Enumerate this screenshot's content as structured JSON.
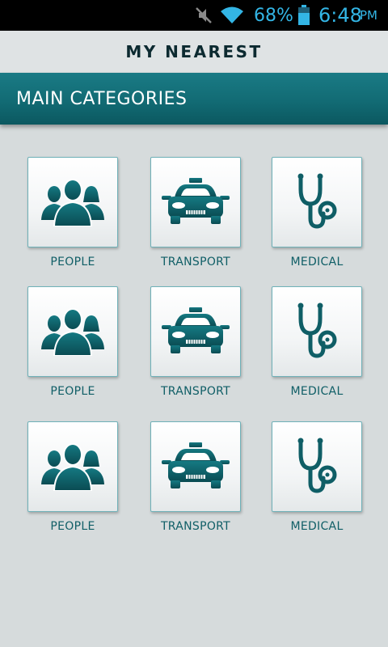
{
  "status_bar": {
    "battery_percent": "68%",
    "time": "6:48",
    "ampm": "PM",
    "icons": [
      "mute-icon",
      "wifi-icon",
      "battery-icon"
    ]
  },
  "app": {
    "title": "MY NEAREST"
  },
  "section": {
    "title": "MAIN CATEGORIES"
  },
  "categories": [
    {
      "label": "PEOPLE",
      "icon": "people-icon"
    },
    {
      "label": "TRANSPORT",
      "icon": "car-icon"
    },
    {
      "label": "MEDICAL",
      "icon": "stethoscope-icon"
    },
    {
      "label": "PEOPLE",
      "icon": "people-icon"
    },
    {
      "label": "TRANSPORT",
      "icon": "car-icon"
    },
    {
      "label": "MEDICAL",
      "icon": "stethoscope-icon"
    },
    {
      "label": "PEOPLE",
      "icon": "people-icon"
    },
    {
      "label": "TRANSPORT",
      "icon": "car-icon"
    },
    {
      "label": "MEDICAL",
      "icon": "stethoscope-icon"
    }
  ],
  "colors": {
    "accent": "#126b74",
    "icon": "#0f5e66",
    "background": "#d6dbdc"
  }
}
